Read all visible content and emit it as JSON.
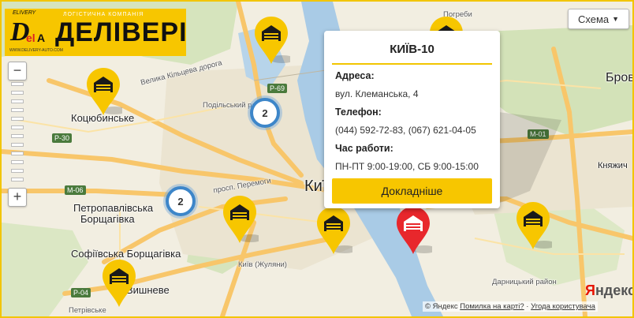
{
  "logo": {
    "brand": "ДЕЛІВЕРІ",
    "tagline": "ЛОГІСТИЧНА КОМПАНІЯ",
    "mark_text": "DelA",
    "mark_top": "ELIVERY",
    "mark_sub": "AUTO",
    "url": "WWW.DELIVERY-AUTO.COM"
  },
  "map_type_button": {
    "label": "Схема",
    "arrow": "▼"
  },
  "zoom": {
    "plus": "+",
    "minus": "−"
  },
  "balloon": {
    "title": "КИЇВ-10",
    "address_label": "Адреса:",
    "address": "вул. Клеманська, 4",
    "phone_label": "Телефон:",
    "phone": "(044) 592-72-83, (067) 621-04-05",
    "hours_label": "Час работи:",
    "hours": "ПН-ПТ 9:00-19:00, СБ 9:00-15:00",
    "details_button": "Докладніше"
  },
  "clusters": [
    {
      "count": "2"
    },
    {
      "count": "2"
    }
  ],
  "map_labels": {
    "kotsiubynske": "Коцюбинське",
    "petropavlivska": "Петропавлівська",
    "borshchahivka": "Борщагівка",
    "sofiivska": "Софіївська Борщагівка",
    "vyshneve": "Вишневе",
    "petrivske": "Петрівське",
    "kyiv": "Київ",
    "brovary": "Бров",
    "kniazhychi": "Княжич",
    "pohrebi": "Погреби",
    "ring_road": "Велика Кільцева дорога",
    "podilskyi": "Подільський район",
    "peremohy": "просп. Перемоги",
    "zhuliany": "Київ (Жуляни)",
    "darnytskyi": "Дарницький район",
    "r69": "Р-69",
    "r30": "Р-30",
    "m06": "М-06",
    "m01": "М-01",
    "r04": "Р-04"
  },
  "copyright": {
    "owner": "© Яндекс",
    "error_link": "Помилка на карті?",
    "sep": "·",
    "terms_link": "Угода користувача"
  },
  "yandex_logo": {
    "y": "Я",
    "rest": "ндекс"
  },
  "colors": {
    "accent": "#f7c600",
    "frame": "#f2c500",
    "active_pin": "#e8272c",
    "cluster_ring": "#3d86c9",
    "road_major": "#f8c66a",
    "water": "#a9cbe6",
    "park": "#cfe0b4"
  }
}
